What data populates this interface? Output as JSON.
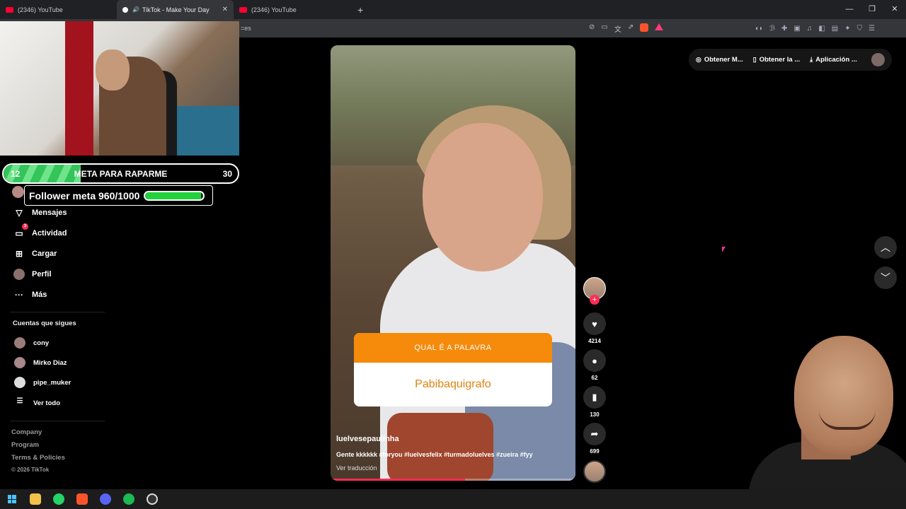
{
  "browser": {
    "tabs": [
      {
        "title": "(2346) YouTube",
        "active": false
      },
      {
        "title": "TikTok - Make Your Day",
        "active": true
      },
      {
        "title": "(2346) YouTube",
        "active": false
      }
    ],
    "new_tab": "+",
    "url_fragment": "=es",
    "window_controls": {
      "minimize": "—",
      "restore": "❐",
      "close": "✕"
    }
  },
  "stream_overlay": {
    "goal": {
      "start": "12",
      "title": "META PARA RAPARME",
      "end": "30",
      "progress": 0.33
    },
    "follower_goal": {
      "label": "Follower meta 960/1000",
      "progress": 0.96
    }
  },
  "sidebar": {
    "nav": [
      {
        "label": "Mensajes",
        "icon": "send-icon"
      },
      {
        "label": "Actividad",
        "icon": "activity-icon",
        "badge": "3"
      },
      {
        "label": "Cargar",
        "icon": "upload-icon"
      },
      {
        "label": "Perfil",
        "icon": "profile-avatar-icon"
      },
      {
        "label": "Más",
        "icon": "more-icon"
      }
    ],
    "following_title": "Cuentas que sigues",
    "following": [
      {
        "name": "cony"
      },
      {
        "name": "Mirko Diaz"
      },
      {
        "name": "pipe_muker"
      }
    ],
    "see_all": "Ver todo",
    "footer": [
      "Company",
      "Program",
      "Terms & Policies"
    ],
    "copyright": "© 2026 TikTok"
  },
  "video": {
    "quiz_question": "QUAL É A PALAVRA",
    "quiz_answer": "Pabibaquigrafo",
    "username": "luelvesepaulinha",
    "caption": "Gente kkkkkk #foryou #luelvesfelix #turmadoluelves #zueira #fyy",
    "translate": "Ver traducción",
    "progress": 0.55
  },
  "actions": {
    "likes": "4214",
    "comments": "62",
    "saves": "130",
    "shares": "699",
    "follow_plus": "+"
  },
  "top_right": {
    "items": [
      {
        "label": "Obtener M...",
        "icon": "coin-icon"
      },
      {
        "label": "Obtener la ...",
        "icon": "phone-icon"
      },
      {
        "label": "Aplicación ...",
        "icon": "download-icon"
      }
    ]
  },
  "scroll": {
    "up": "︿",
    "down": "﹀"
  },
  "colors": {
    "tiktok_red": "#fe2c55",
    "quiz_orange": "#f58a0b",
    "goal_green": "#33c45a"
  }
}
